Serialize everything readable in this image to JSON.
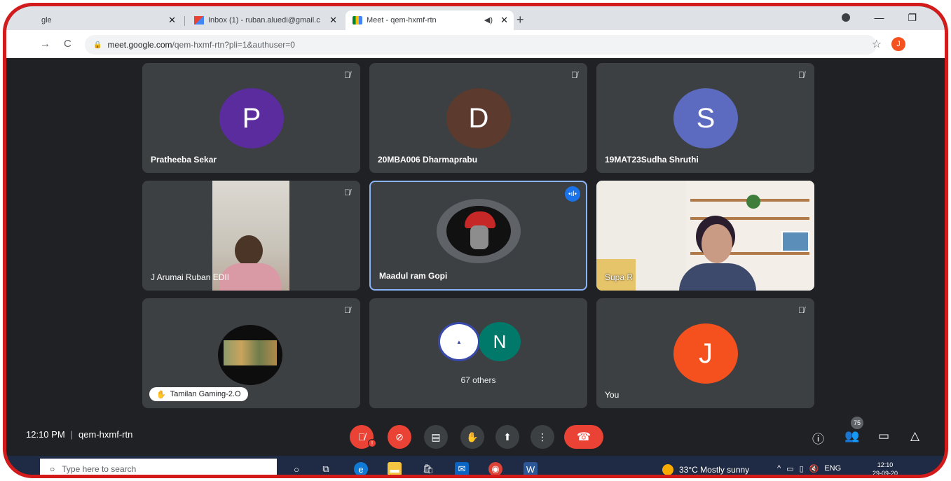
{
  "browser": {
    "tabs": [
      {
        "label": "gle"
      },
      {
        "label": "Inbox (1) - ruban.aluedi@gmail.c"
      },
      {
        "label": "Meet - qem-hxmf-rtn"
      }
    ],
    "address": {
      "host": "meet.google.com",
      "path": "/qem-hxmf-rtn?pli=1&authuser=0"
    },
    "profile_initial": "J"
  },
  "meet": {
    "participants": [
      {
        "name": "Pratheeba Sekar",
        "initial": "P",
        "color": "#5b2c9e"
      },
      {
        "name": "20MBA006 Dharmaprabu",
        "initial": "D",
        "color": "#5d3a2e"
      },
      {
        "name": "19MAT23Sudha Shruthi",
        "initial": "S",
        "color": "#5c6bc0"
      },
      {
        "name": "J Arumai Ruban EDII"
      },
      {
        "name": "Maadul ram Gopi"
      },
      {
        "name": "Supa R"
      },
      {
        "name": "Tamilan Gaming-2.O"
      },
      {
        "name": "67 others",
        "initial": "N",
        "color": "#00796b"
      },
      {
        "name": "You",
        "initial": "J",
        "color": "#f4511e"
      }
    ],
    "bar": {
      "time": "12:10 PM",
      "meeting_code": "qem-hxmf-rtn",
      "people_count": "75"
    }
  },
  "taskbar": {
    "search_placeholder": "Type here to search",
    "weather": "33°C  Mostly sunny",
    "lang": "ENG",
    "time": "12:10",
    "date": "29-09-20"
  }
}
